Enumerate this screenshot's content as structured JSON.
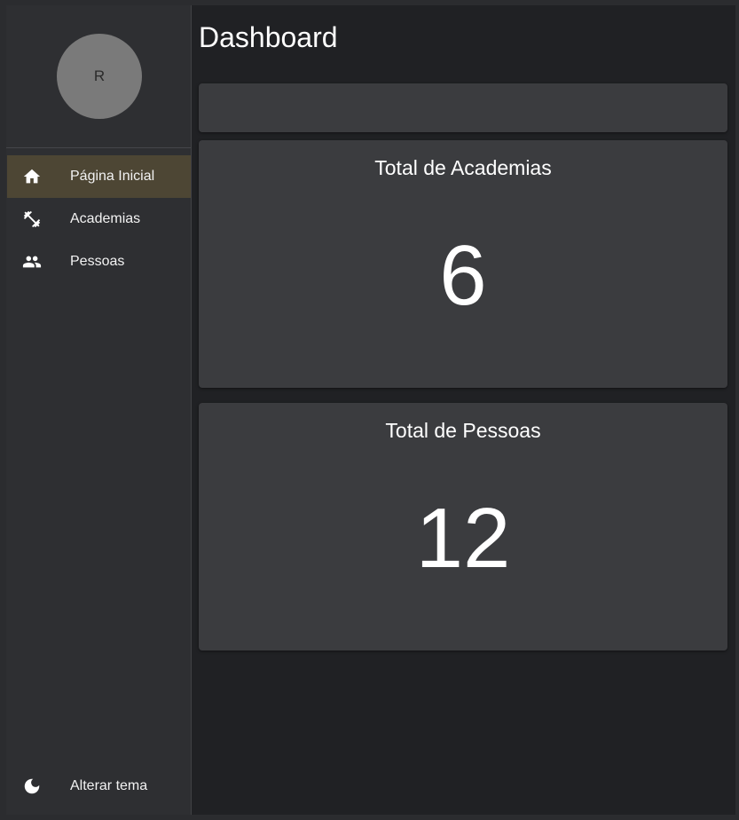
{
  "sidebar": {
    "avatar_initial": "R",
    "items": [
      {
        "label": "Página Inicial",
        "icon": "home-icon",
        "active": true
      },
      {
        "label": "Academias",
        "icon": "dumbbell-icon",
        "active": false
      },
      {
        "label": "Pessoas",
        "icon": "people-icon",
        "active": false
      }
    ],
    "theme_toggle": {
      "label": "Alterar tema",
      "icon": "moon-icon"
    }
  },
  "main": {
    "title": "Dashboard",
    "stats": [
      {
        "title": "Total de Academias",
        "value": "6"
      },
      {
        "title": "Total de Pessoas",
        "value": "12"
      }
    ]
  },
  "colors": {
    "background": "#202124",
    "sidebar": "#2e2f32",
    "card": "#3b3c3f",
    "active_item": "#4d4634",
    "avatar": "#7a7a7a"
  }
}
